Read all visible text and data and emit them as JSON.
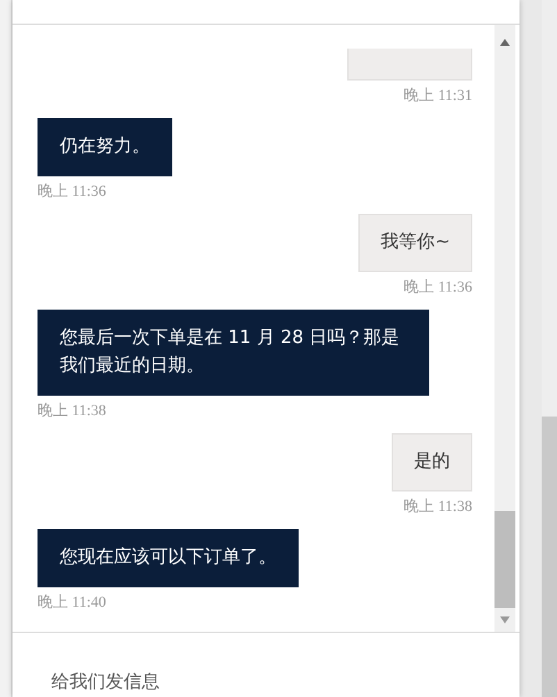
{
  "messages": [
    {
      "kind": "outgoing",
      "time": "晚上 11:31"
    },
    {
      "kind": "incoming",
      "text": "仍在努力。",
      "time": "晚上 11:36"
    },
    {
      "kind": "outgoing",
      "text": "我等你~",
      "time": "晚上 11:36"
    },
    {
      "kind": "incoming",
      "text": "您最后一次下单是在 11 月 28 日吗？那是我们最近的日期。",
      "time": "晚上 11:38"
    },
    {
      "kind": "outgoing",
      "text": "是的",
      "time": "晚上 11:38"
    },
    {
      "kind": "incoming",
      "text": "您现在应该可以下订单了。",
      "time": "晚上 11:40"
    }
  ],
  "composer": {
    "placeholder": "给我们发信息"
  }
}
